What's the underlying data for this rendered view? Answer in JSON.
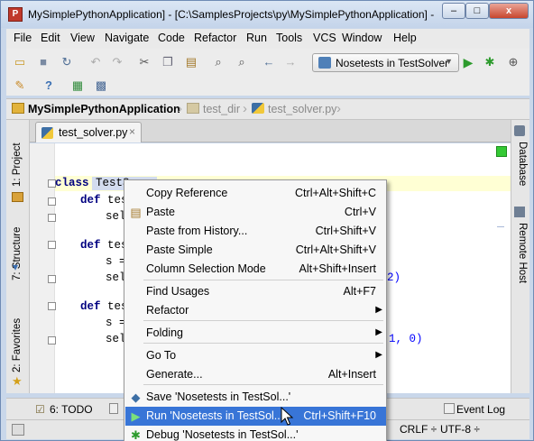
{
  "window": {
    "title": "MySimplePythonApplication] - [C:\\SamplesProjects\\py\\MySimplePythonApplication] -",
    "minimize": "–",
    "maximize": "□",
    "close": "x"
  },
  "menu": [
    "File",
    "Edit",
    "View",
    "Navigate",
    "Code",
    "Refactor",
    "Run",
    "Tools",
    "VCS",
    "Window",
    "Help"
  ],
  "toolbar": {
    "run_config": "Nosetests in TestSolver"
  },
  "breadcrumb": [
    "MySimplePythonApplication",
    "test_dir",
    "test_solver.py"
  ],
  "left_tools": [
    "1: Project",
    "7: Structure",
    "2: Favorites"
  ],
  "right_tools": [
    "Database",
    "Remote Host"
  ],
  "editor": {
    "tab": "test_solver.py",
    "lines": [
      {
        "kw": "class",
        "text": " TestS"
      },
      {
        "kw": "def",
        "text": " tes"
      },
      {
        "kw": "",
        "text": "sel"
      },
      {
        "kw": "def",
        "text": " tes"
      },
      {
        "kw": "",
        "text": "s ="
      },
      {
        "kw": "",
        "text": "sel"
      },
      {
        "kw": "def",
        "text": " tes"
      },
      {
        "kw": "",
        "text": "s ="
      },
      {
        "kw": "",
        "text": "sel"
      }
    ],
    "peek_right": [
      "2)",
      "1, 0)"
    ]
  },
  "context_menu": [
    {
      "label": "Copy Reference",
      "shortcut": "Ctrl+Alt+Shift+C",
      "icon": "",
      "submenu": false
    },
    {
      "label": "Paste",
      "shortcut": "Ctrl+V",
      "icon": "clipboard-icon",
      "submenu": false
    },
    {
      "label": "Paste from History...",
      "shortcut": "Ctrl+Shift+V",
      "icon": "",
      "submenu": false
    },
    {
      "label": "Paste Simple",
      "shortcut": "Ctrl+Alt+Shift+V",
      "icon": "",
      "submenu": false
    },
    {
      "label": "Column Selection Mode",
      "shortcut": "Alt+Shift+Insert",
      "icon": "",
      "submenu": false
    },
    {
      "label": "Find Usages",
      "shortcut": "Alt+F7",
      "icon": "",
      "submenu": false
    },
    {
      "label": "Refactor",
      "shortcut": "",
      "icon": "",
      "submenu": true
    },
    {
      "label": "Folding",
      "shortcut": "",
      "icon": "",
      "submenu": true
    },
    {
      "label": "Go To",
      "shortcut": "",
      "icon": "",
      "submenu": true
    },
    {
      "label": "Generate...",
      "shortcut": "Alt+Insert",
      "icon": "",
      "submenu": false
    },
    {
      "label": "Save 'Nosetests in TestSol...'",
      "shortcut": "",
      "icon": "python-icon",
      "submenu": false
    },
    {
      "label": "Run 'Nosetests in TestSol...'",
      "shortcut": "Ctrl+Shift+F10",
      "icon": "run-icon",
      "submenu": false,
      "selected": true
    },
    {
      "label": "Debug 'Nosetests in TestSol...'",
      "shortcut": "",
      "icon": "debug-icon",
      "submenu": false
    }
  ],
  "bottom_tools": {
    "todo": "6: TODO",
    "event_log": "Event Log"
  },
  "status": {
    "line_sep": "CRLF ÷",
    "encoding": "UTF-8 ÷"
  },
  "colors": {
    "selection": "#3875d7",
    "caret_line": "#ffffd4",
    "run_green": "#2d9b2d"
  }
}
